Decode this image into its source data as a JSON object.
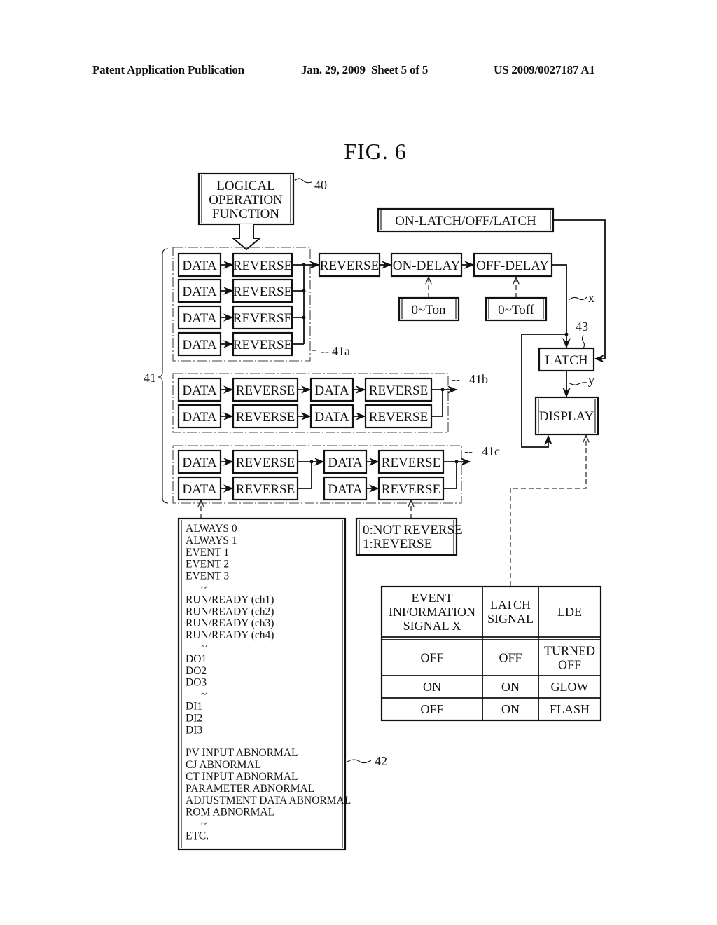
{
  "header": {
    "left": "Patent Application Publication",
    "center": "Jan. 29, 2009  Sheet 5 of 5",
    "right": "US 2009/0027187 A1"
  },
  "figure": {
    "title": "FIG. 6",
    "logical_operation": {
      "lines": [
        "LOGICAL",
        "OPERATION",
        "FUNCTION"
      ],
      "ref": "40"
    },
    "mode_select": "ON-LATCH/OFF/LATCH",
    "chain": {
      "reverse": "REVERSE",
      "on_delay": "ON-DELAY",
      "off_delay": "OFF-DELAY"
    },
    "ton": "0~Ton",
    "toff": "0~Toff",
    "latch": {
      "label": "LATCH",
      "ref": "43"
    },
    "display": "DISPLAY",
    "signal_x": "x",
    "signal_y": "y",
    "group_ref": "41",
    "group_a": {
      "ref": "41a",
      "data": "DATA",
      "reverse": "REVERSE"
    },
    "group_b": {
      "ref": "41b",
      "data": "DATA",
      "reverse": "REVERSE"
    },
    "group_c": {
      "ref": "41c",
      "data": "DATA",
      "reverse": "REVERSE"
    },
    "reverse_select": [
      "0:NOT REVERSE",
      "1:REVERSE"
    ],
    "source_list": {
      "ref": "42",
      "items": [
        "ALWAYS 0",
        "ALWAYS 1",
        "EVENT 1",
        "EVENT 2",
        "EVENT 3",
        "~",
        "RUN/READY (ch1)",
        "RUN/READY (ch2)",
        "RUN/READY (ch3)",
        "RUN/READY (ch4)",
        "~",
        "DO1",
        "DO2",
        "DO3",
        "~",
        "DI1",
        "DI2",
        "DI3",
        "",
        "PV INPUT ABNORMAL",
        "CJ ABNORMAL",
        "CT INPUT ABNORMAL",
        "PARAMETER ABNORMAL",
        "ADJUSTMENT DATA ABNORMAL",
        "ROM ABNORMAL",
        "~",
        "ETC."
      ]
    },
    "truth_table": {
      "headers": [
        [
          "EVENT",
          "INFORMATION",
          "SIGNAL X"
        ],
        [
          "LATCH",
          "SIGNAL"
        ],
        [
          "LDE"
        ]
      ],
      "rows": [
        [
          [
            "OFF"
          ],
          [
            "OFF"
          ],
          [
            "TURNED",
            "OFF"
          ]
        ],
        [
          [
            "ON"
          ],
          [
            "ON"
          ],
          [
            "GLOW"
          ]
        ],
        [
          [
            "OFF"
          ],
          [
            "ON"
          ],
          [
            "FLASH"
          ]
        ]
      ]
    }
  }
}
